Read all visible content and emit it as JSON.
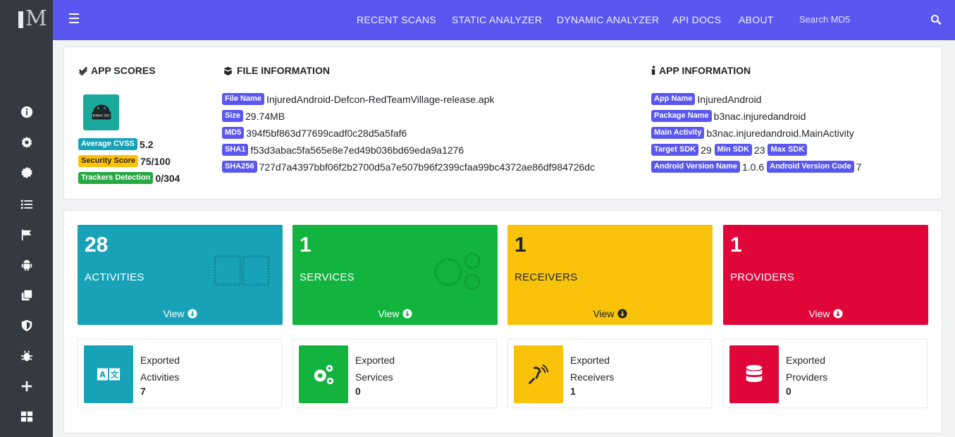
{
  "nav": {
    "links": [
      "RECENT SCANS",
      "STATIC ANALYZER",
      "DYNAMIC ANALYZER",
      "API DOCS",
      "ABOUT"
    ],
    "search_placeholder": "Search MD5"
  },
  "sidebar": {
    "icons": [
      "info-icon",
      "gear-icon",
      "cog-badge-icon",
      "list-icon",
      "flag-icon",
      "android-icon",
      "copy-icon",
      "shield-icon",
      "bug-icon",
      "plus-icon",
      "grid-icon"
    ]
  },
  "app_scores": {
    "title": "APP SCORES",
    "cvss_label": "Average CVSS",
    "cvss_value": "5.2",
    "security_label": "Security Score",
    "security_value": "75/100",
    "trackers_label": "Trackers Detection",
    "trackers_value": "0/304",
    "icon_text": "B3NAC.SEC"
  },
  "file_info": {
    "title": "FILE INFORMATION",
    "rows": [
      {
        "label": "File Name",
        "value": "InjuredAndroid-Defcon-RedTeamVillage-release.apk"
      },
      {
        "label": "Size",
        "value": "29.74MB"
      },
      {
        "label": "MD5",
        "value": "394f5bf863d77699cadf0c28d5a5faf6"
      },
      {
        "label": "SHA1",
        "value": "f53d3abac5fa565e8e7ed49b036bd69eda9a1276"
      },
      {
        "label": "SHA256",
        "value": "727d7a4397bbf06f2b2700d5a7e507b96f2399cfaa99bc4372ae86df984726dc"
      }
    ]
  },
  "app_info": {
    "title": "APP INFORMATION",
    "app_name_label": "App Name",
    "app_name": "InjuredAndroid",
    "package_label": "Package Name",
    "package": "b3nac.injuredandroid",
    "main_activity_label": "Main Activity",
    "main_activity": "b3nac.injuredandroid.MainActivity",
    "target_sdk_label": "Target SDK",
    "target_sdk": "29",
    "min_sdk_label": "Min SDK",
    "min_sdk": "23",
    "max_sdk_label": "Max SDK",
    "version_name_label": "Android Version Name",
    "version_name": "1.0.6",
    "version_code_label": "Android Version Code",
    "version_code": "7"
  },
  "tiles": [
    {
      "count": "28",
      "label": "ACTIVITIES",
      "view": "View",
      "color": "#17a2b8"
    },
    {
      "count": "1",
      "label": "SERVICES",
      "view": "View",
      "color": "#12b33e"
    },
    {
      "count": "1",
      "label": "RECEIVERS",
      "view": "View",
      "color": "#f8c30a"
    },
    {
      "count": "1",
      "label": "PROVIDERS",
      "view": "View",
      "color": "#e0063a"
    }
  ],
  "exported": [
    {
      "line1": "Exported",
      "line2": "Activities",
      "count": "7",
      "color": "#17a2b8",
      "icon": "language-icon"
    },
    {
      "line1": "Exported",
      "line2": "Services",
      "count": "0",
      "color": "#12b33e",
      "icon": "cogs-icon"
    },
    {
      "line1": "Exported",
      "line2": "Receivers",
      "count": "1",
      "color": "#f8c30a",
      "icon": "assistive-listening-icon"
    },
    {
      "line1": "Exported",
      "line2": "Providers",
      "count": "0",
      "color": "#e0063a",
      "icon": "database-icon"
    }
  ]
}
